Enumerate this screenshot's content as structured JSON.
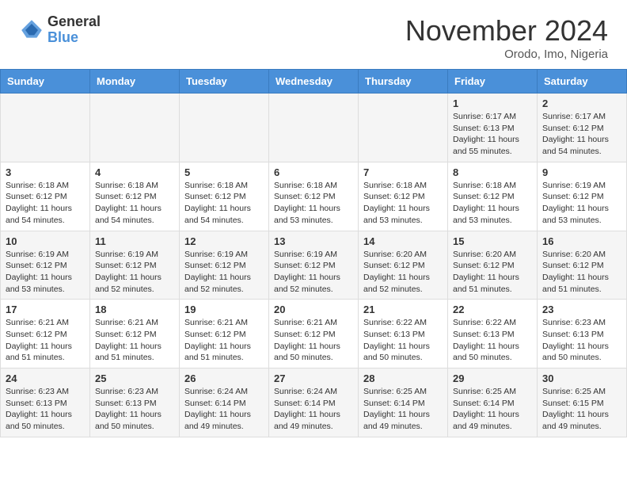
{
  "header": {
    "logo_general": "General",
    "logo_blue": "Blue",
    "month_title": "November 2024",
    "location": "Orodo, Imo, Nigeria"
  },
  "days_of_week": [
    "Sunday",
    "Monday",
    "Tuesday",
    "Wednesday",
    "Thursday",
    "Friday",
    "Saturday"
  ],
  "weeks": [
    [
      {
        "day": "",
        "info": ""
      },
      {
        "day": "",
        "info": ""
      },
      {
        "day": "",
        "info": ""
      },
      {
        "day": "",
        "info": ""
      },
      {
        "day": "",
        "info": ""
      },
      {
        "day": "1",
        "info": "Sunrise: 6:17 AM\nSunset: 6:13 PM\nDaylight: 11 hours and 55 minutes."
      },
      {
        "day": "2",
        "info": "Sunrise: 6:17 AM\nSunset: 6:12 PM\nDaylight: 11 hours and 54 minutes."
      }
    ],
    [
      {
        "day": "3",
        "info": "Sunrise: 6:18 AM\nSunset: 6:12 PM\nDaylight: 11 hours and 54 minutes."
      },
      {
        "day": "4",
        "info": "Sunrise: 6:18 AM\nSunset: 6:12 PM\nDaylight: 11 hours and 54 minutes."
      },
      {
        "day": "5",
        "info": "Sunrise: 6:18 AM\nSunset: 6:12 PM\nDaylight: 11 hours and 54 minutes."
      },
      {
        "day": "6",
        "info": "Sunrise: 6:18 AM\nSunset: 6:12 PM\nDaylight: 11 hours and 53 minutes."
      },
      {
        "day": "7",
        "info": "Sunrise: 6:18 AM\nSunset: 6:12 PM\nDaylight: 11 hours and 53 minutes."
      },
      {
        "day": "8",
        "info": "Sunrise: 6:18 AM\nSunset: 6:12 PM\nDaylight: 11 hours and 53 minutes."
      },
      {
        "day": "9",
        "info": "Sunrise: 6:19 AM\nSunset: 6:12 PM\nDaylight: 11 hours and 53 minutes."
      }
    ],
    [
      {
        "day": "10",
        "info": "Sunrise: 6:19 AM\nSunset: 6:12 PM\nDaylight: 11 hours and 53 minutes."
      },
      {
        "day": "11",
        "info": "Sunrise: 6:19 AM\nSunset: 6:12 PM\nDaylight: 11 hours and 52 minutes."
      },
      {
        "day": "12",
        "info": "Sunrise: 6:19 AM\nSunset: 6:12 PM\nDaylight: 11 hours and 52 minutes."
      },
      {
        "day": "13",
        "info": "Sunrise: 6:19 AM\nSunset: 6:12 PM\nDaylight: 11 hours and 52 minutes."
      },
      {
        "day": "14",
        "info": "Sunrise: 6:20 AM\nSunset: 6:12 PM\nDaylight: 11 hours and 52 minutes."
      },
      {
        "day": "15",
        "info": "Sunrise: 6:20 AM\nSunset: 6:12 PM\nDaylight: 11 hours and 51 minutes."
      },
      {
        "day": "16",
        "info": "Sunrise: 6:20 AM\nSunset: 6:12 PM\nDaylight: 11 hours and 51 minutes."
      }
    ],
    [
      {
        "day": "17",
        "info": "Sunrise: 6:21 AM\nSunset: 6:12 PM\nDaylight: 11 hours and 51 minutes."
      },
      {
        "day": "18",
        "info": "Sunrise: 6:21 AM\nSunset: 6:12 PM\nDaylight: 11 hours and 51 minutes."
      },
      {
        "day": "19",
        "info": "Sunrise: 6:21 AM\nSunset: 6:12 PM\nDaylight: 11 hours and 51 minutes."
      },
      {
        "day": "20",
        "info": "Sunrise: 6:21 AM\nSunset: 6:12 PM\nDaylight: 11 hours and 50 minutes."
      },
      {
        "day": "21",
        "info": "Sunrise: 6:22 AM\nSunset: 6:13 PM\nDaylight: 11 hours and 50 minutes."
      },
      {
        "day": "22",
        "info": "Sunrise: 6:22 AM\nSunset: 6:13 PM\nDaylight: 11 hours and 50 minutes."
      },
      {
        "day": "23",
        "info": "Sunrise: 6:23 AM\nSunset: 6:13 PM\nDaylight: 11 hours and 50 minutes."
      }
    ],
    [
      {
        "day": "24",
        "info": "Sunrise: 6:23 AM\nSunset: 6:13 PM\nDaylight: 11 hours and 50 minutes."
      },
      {
        "day": "25",
        "info": "Sunrise: 6:23 AM\nSunset: 6:13 PM\nDaylight: 11 hours and 50 minutes."
      },
      {
        "day": "26",
        "info": "Sunrise: 6:24 AM\nSunset: 6:14 PM\nDaylight: 11 hours and 49 minutes."
      },
      {
        "day": "27",
        "info": "Sunrise: 6:24 AM\nSunset: 6:14 PM\nDaylight: 11 hours and 49 minutes."
      },
      {
        "day": "28",
        "info": "Sunrise: 6:25 AM\nSunset: 6:14 PM\nDaylight: 11 hours and 49 minutes."
      },
      {
        "day": "29",
        "info": "Sunrise: 6:25 AM\nSunset: 6:14 PM\nDaylight: 11 hours and 49 minutes."
      },
      {
        "day": "30",
        "info": "Sunrise: 6:25 AM\nSunset: 6:15 PM\nDaylight: 11 hours and 49 minutes."
      }
    ]
  ]
}
